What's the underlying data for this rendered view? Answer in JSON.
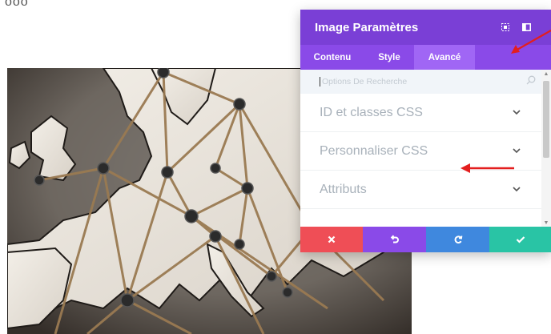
{
  "clipped_heading": "ooo",
  "photo": {
    "description_icon": "europe-map-string-icon"
  },
  "panel": {
    "title": "Image Paramètres",
    "header_icons": [
      "expand-icon",
      "split-view-icon"
    ],
    "tabs": [
      {
        "label": "Contenu",
        "active": false
      },
      {
        "label": "Style",
        "active": false
      },
      {
        "label": "Avancé",
        "active": true
      }
    ],
    "search": {
      "placeholder": "Options De Recherche",
      "value": ""
    },
    "sections": [
      {
        "label": "ID et classes CSS"
      },
      {
        "label": "Personnaliser CSS"
      },
      {
        "label": "Attributs"
      }
    ],
    "footer_buttons": [
      {
        "name": "cancel-button",
        "icon": "close-icon",
        "color": "#ef4e56"
      },
      {
        "name": "undo-button",
        "icon": "undo-icon",
        "color": "#8a4ae8"
      },
      {
        "name": "redo-button",
        "icon": "redo-icon",
        "color": "#3f88de"
      },
      {
        "name": "save-button",
        "icon": "check-icon",
        "color": "#29c4a5"
      }
    ]
  },
  "colors": {
    "header": "#7a3fd6",
    "tabs_bar": "#8a4ae8",
    "tab_active": "#a066f5",
    "annotation_arrow": "#e31e1e"
  }
}
